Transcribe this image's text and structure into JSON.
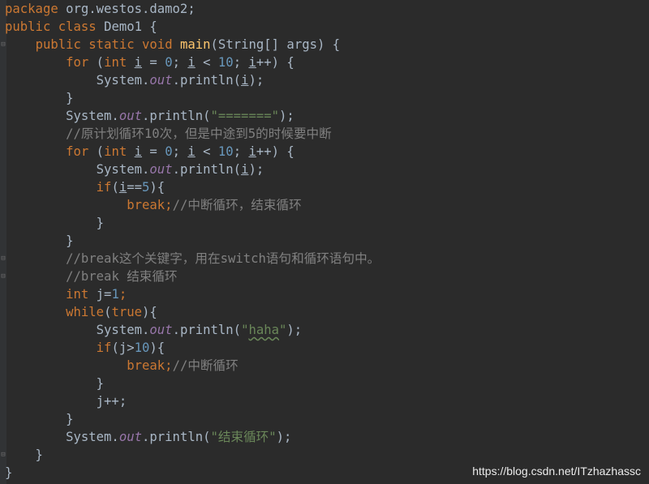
{
  "code": {
    "l1": [
      "package",
      " org.westos.damo2;"
    ],
    "l2": [
      "public",
      " ",
      "class",
      " Demo1 {"
    ],
    "l3": [
      "    ",
      "public",
      " ",
      "static",
      " ",
      "void",
      " ",
      "main",
      "(String[] args) {"
    ],
    "l4": [
      "        ",
      "for",
      " (",
      "int",
      " ",
      "i",
      " = ",
      "0",
      "; ",
      "i",
      " < ",
      "10",
      "; ",
      "i",
      "++) {"
    ],
    "l5": [
      "            System.",
      "out",
      ".println(",
      "i",
      ");"
    ],
    "l6": [
      "        }"
    ],
    "l7": [
      "        System.",
      "out",
      ".println(",
      "\"=======\"",
      ");"
    ],
    "l8": [
      "        ",
      "//原计划循环10次，但是中途到5的时候要中断"
    ],
    "l9": [
      "        ",
      "for",
      " (",
      "int",
      " ",
      "i",
      " = ",
      "0",
      "; ",
      "i",
      " < ",
      "10",
      "; ",
      "i",
      "++) {"
    ],
    "l10": [
      "            System.",
      "out",
      ".println(",
      "i",
      ");"
    ],
    "l11": [
      "            ",
      "if",
      "(",
      "i",
      "==",
      "5",
      "){"
    ],
    "l12": [
      "                ",
      "break;",
      "//中断循环，结束循环"
    ],
    "l13": [
      "            }"
    ],
    "l14": [
      "        }"
    ],
    "l15": [
      "        ",
      "//break这个关键字，用在switch语句和循环语句中。"
    ],
    "l16": [
      "        ",
      "//break 结束循环"
    ],
    "l17": [
      "        ",
      "int",
      " j=",
      "1",
      ";"
    ],
    "l18": [
      "        ",
      "while",
      "(",
      "true",
      "){"
    ],
    "l19": [
      "            System.",
      "out",
      ".println(",
      "\"",
      "haha",
      "\"",
      ");"
    ],
    "l20": [
      "            ",
      "if",
      "(j>",
      "10",
      "){"
    ],
    "l21": [
      "                ",
      "break;",
      "//中断循环"
    ],
    "l22": [
      "            }"
    ],
    "l23": [
      "            j++;"
    ],
    "l24": [
      "        }"
    ],
    "l25": [
      "        System.",
      "out",
      ".println(",
      "\"结束循环\"",
      ");"
    ],
    "l26": [
      "    }"
    ],
    "l27": [
      "}"
    ]
  },
  "watermark": "https://blog.csdn.net/ITzhazhassc",
  "colors": {
    "background": "#2b2b2b",
    "keyword": "#cc7832",
    "method": "#ffc66d",
    "number": "#6897bb",
    "string": "#6a8759",
    "comment": "#808080",
    "field": "#9876aa",
    "text": "#a9b7c6"
  }
}
